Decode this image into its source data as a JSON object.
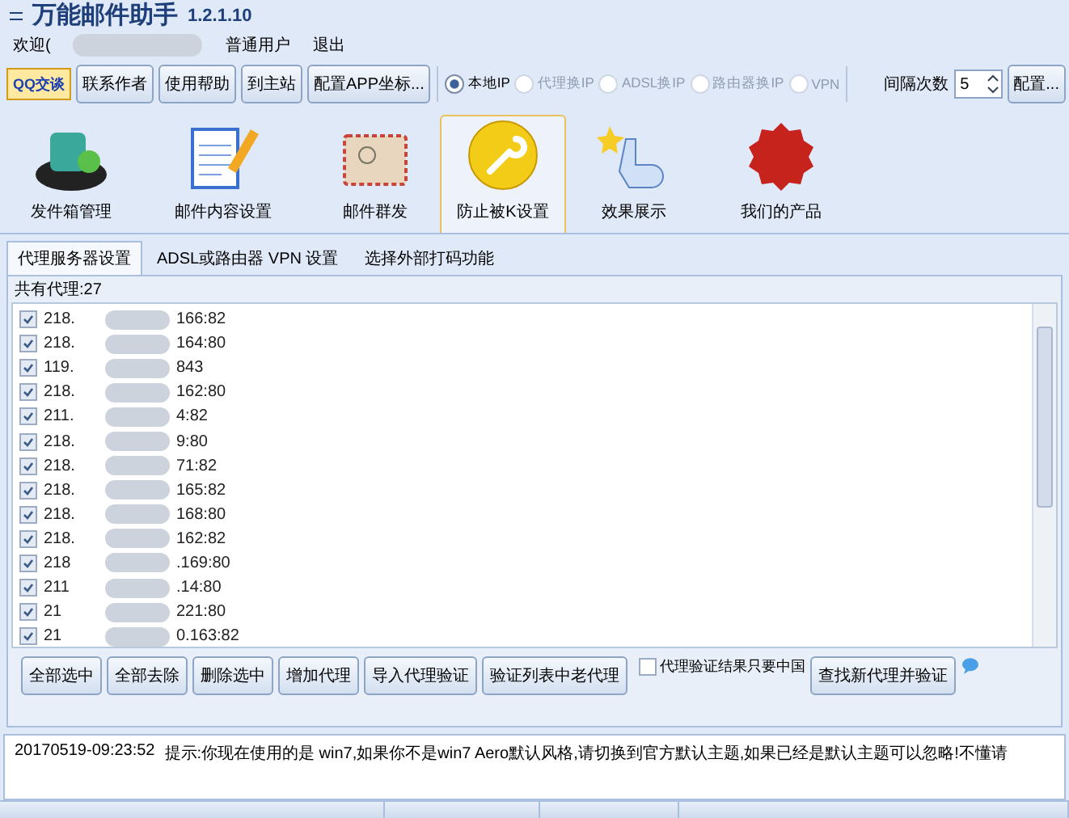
{
  "window": {
    "title": "万能邮件助手",
    "version": "1.2.1.10"
  },
  "menu": [
    {
      "label": "欢迎("
    },
    {
      "label": "普通用户"
    },
    {
      "label": "退出"
    }
  ],
  "toolbar": {
    "qq_button": "QQ交谈",
    "buttons": [
      "联系作者",
      "使用帮助",
      "到主站",
      "配置APP坐标..."
    ],
    "ip_modes": [
      {
        "label": "本地IP",
        "selected": true,
        "disabled": false
      },
      {
        "label": "代理换IP",
        "selected": false,
        "disabled": true
      },
      {
        "label": "ADSL换IP",
        "selected": false,
        "disabled": true
      },
      {
        "label": "路由器换IP",
        "selected": false,
        "disabled": true
      },
      {
        "label": "VPN",
        "selected": false,
        "disabled": true
      }
    ],
    "interval_label": "间隔次数",
    "interval_value": "5",
    "config_button": "配置..."
  },
  "ribbon": [
    {
      "kind": "outbox",
      "label": "发件箱管理",
      "selected": false
    },
    {
      "kind": "content",
      "label": "邮件内容设置",
      "selected": false
    },
    {
      "kind": "mail",
      "label": "邮件群发",
      "selected": false
    },
    {
      "kind": "wrench",
      "label": "防止被K设置",
      "selected": true
    },
    {
      "kind": "touch",
      "label": "效果展示",
      "selected": false
    },
    {
      "kind": "new",
      "label": "我们的产品",
      "selected": false
    }
  ],
  "tabs": [
    {
      "label": "代理服务器设置",
      "selected": true
    },
    {
      "label": "ADSL或路由器 VPN 设置",
      "selected": false
    },
    {
      "label": "选择外部打码功能",
      "selected": false
    }
  ],
  "proxy_group": {
    "title": "共有代理:27",
    "proxies": [
      {
        "start": "218.",
        "end": "166:82",
        "checked": true
      },
      {
        "start": "218.",
        "end": "164:80",
        "checked": true
      },
      {
        "start": "119.",
        "end": "843",
        "checked": true
      },
      {
        "start": "218.",
        "end": "162:80",
        "checked": true
      },
      {
        "start": "211.",
        "end": "4:82",
        "checked": true
      },
      {
        "start": "218.",
        "end": "9:80",
        "checked": true
      },
      {
        "start": "218.",
        "end": "71:82",
        "checked": true
      },
      {
        "start": "218.",
        "end": "165:82",
        "checked": true
      },
      {
        "start": "218.",
        "end": "168:80",
        "checked": true
      },
      {
        "start": "218.",
        "end": "162:82",
        "checked": true
      },
      {
        "start": "218",
        "end": ".169:80",
        "checked": true
      },
      {
        "start": "211",
        "end": ".14:80",
        "checked": true
      },
      {
        "start": "21",
        "end": "221:80",
        "checked": true
      },
      {
        "start": "21",
        "end": "0.163:82",
        "checked": true
      }
    ]
  },
  "actions": [
    "全部选中",
    "全部去除",
    "删除选中",
    "增加代理",
    "导入代理验证",
    "验证列表中老代理"
  ],
  "china_only": {
    "label": "代理验证结果只要中国",
    "checked": false
  },
  "find_button": "查找新代理并验证",
  "log": [
    {
      "time": "20170519-09:23:52",
      "text": "提示:你现在使用的是 win7,如果你不是win7 Aero默认风格,请切换到官方默认主题,如果已经是默认主题可以忽略!不懂请"
    }
  ]
}
